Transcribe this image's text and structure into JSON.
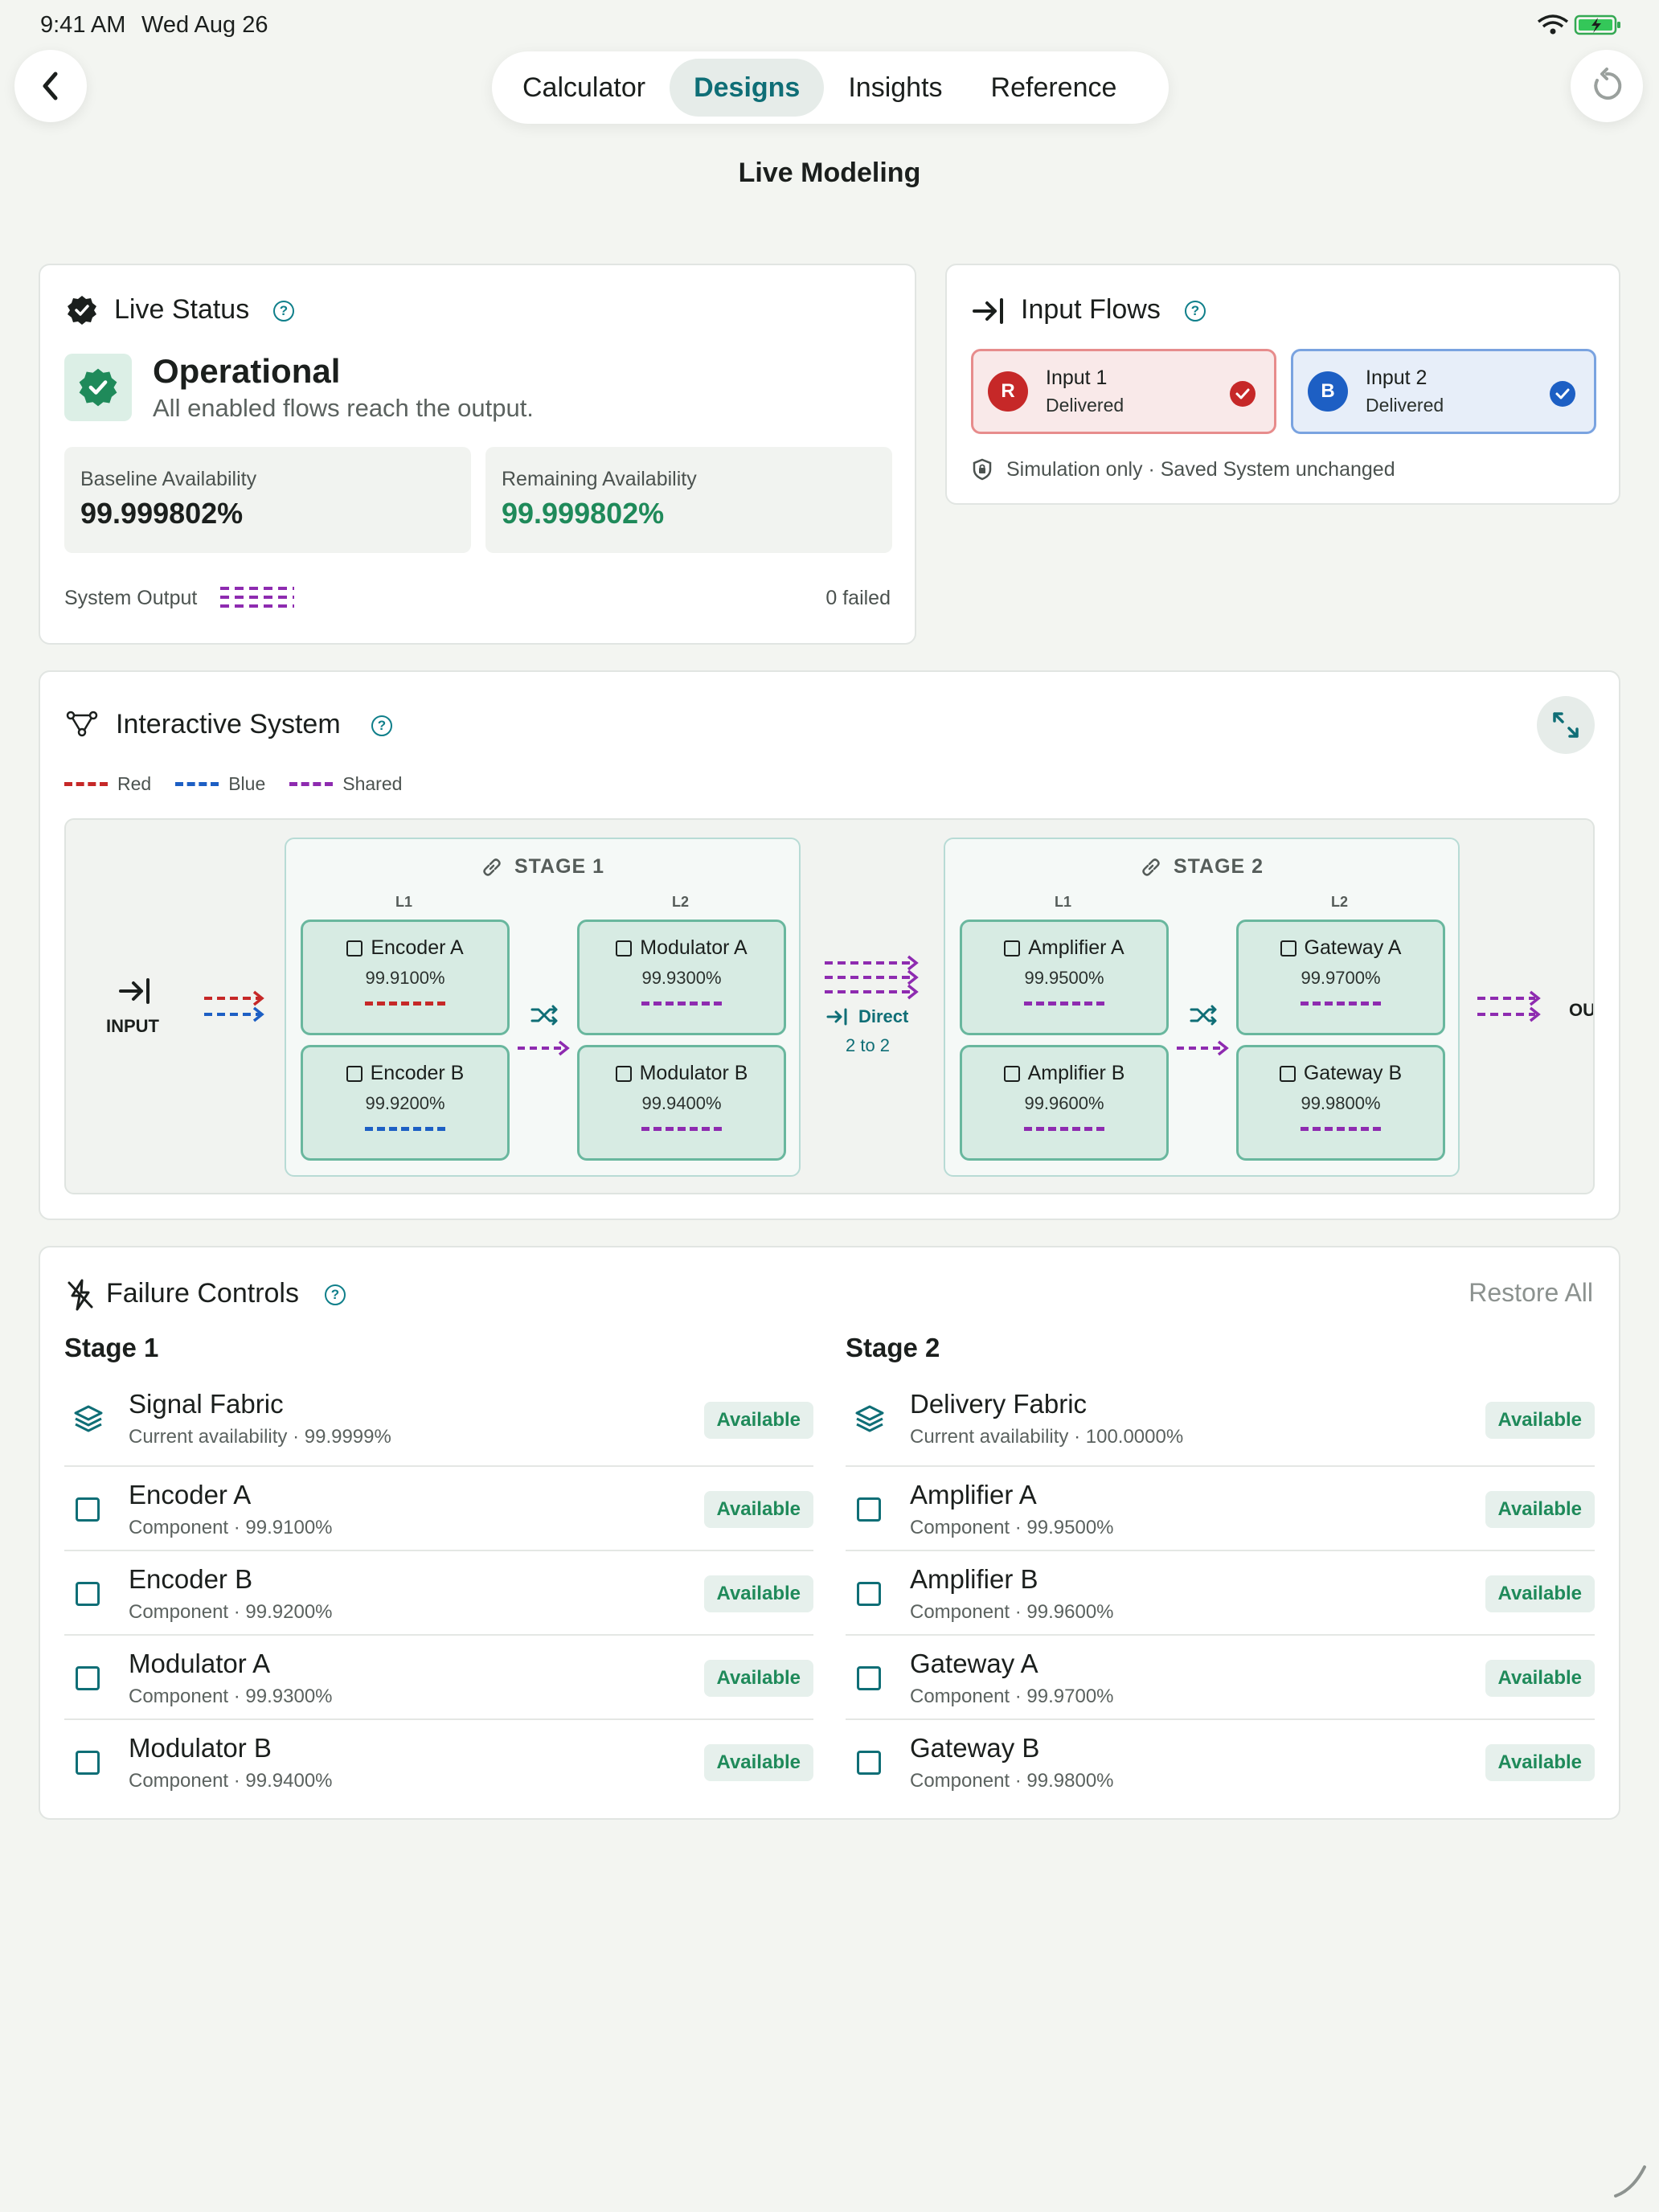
{
  "status_bar": {
    "time": "9:41 AM",
    "date": "Wed Aug 26"
  },
  "nav": {
    "tabs": [
      {
        "label": "Calculator",
        "active": false
      },
      {
        "label": "Designs",
        "active": true
      },
      {
        "label": "Insights",
        "active": false
      },
      {
        "label": "Reference",
        "active": false
      }
    ],
    "back_icon": "chevron-left-icon",
    "reset_icon": "reset-icon"
  },
  "page_title": "Live Modeling",
  "live_status": {
    "title": "Live Status",
    "state": "Operational",
    "description": "All enabled flows reach the output.",
    "baseline_label": "Baseline Availability",
    "baseline_value": "99.999802%",
    "remaining_label": "Remaining Availability",
    "remaining_value": "99.999802%",
    "output_label": "System Output",
    "failed_text": "0 failed"
  },
  "input_flows": {
    "title": "Input Flows",
    "flows": [
      {
        "badge": "R",
        "name": "Input 1",
        "status": "Delivered",
        "color": "#c62828"
      },
      {
        "badge": "B",
        "name": "Input 2",
        "status": "Delivered",
        "color": "#1d5fc4"
      }
    ],
    "note": "Simulation only · Saved System unchanged"
  },
  "interactive_system": {
    "title": "Interactive System",
    "legend": [
      {
        "label": "Red",
        "color": "#c62828"
      },
      {
        "label": "Blue",
        "color": "#1d5fc4"
      },
      {
        "label": "Shared",
        "color": "#8e2bb0"
      }
    ],
    "input_label": "INPUT",
    "output_label": "OU",
    "direct_label": "Direct",
    "direct_sub": "2 to 2",
    "stages": [
      {
        "title": "STAGE 1",
        "col1": "L1",
        "col2": "L2",
        "components": [
          {
            "name": "Encoder A",
            "value": "99.9100%",
            "color": "#c62828"
          },
          {
            "name": "Encoder B",
            "value": "99.9200%",
            "color": "#1d5fc4"
          },
          {
            "name": "Modulator A",
            "value": "99.9300%",
            "color": "#8e2bb0"
          },
          {
            "name": "Modulator B",
            "value": "99.9400%",
            "color": "#8e2bb0"
          }
        ]
      },
      {
        "title": "STAGE 2",
        "col1": "L1",
        "col2": "L2",
        "components": [
          {
            "name": "Amplifier A",
            "value": "99.9500%",
            "color": "#8e2bb0"
          },
          {
            "name": "Amplifier B",
            "value": "99.9600%",
            "color": "#8e2bb0"
          },
          {
            "name": "Gateway A",
            "value": "99.9700%",
            "color": "#8e2bb0"
          },
          {
            "name": "Gateway B",
            "value": "99.9800%",
            "color": "#8e2bb0"
          }
        ]
      }
    ]
  },
  "failure_controls": {
    "title": "Failure Controls",
    "restore_label": "Restore All",
    "columns": [
      {
        "heading": "Stage 1",
        "rows": [
          {
            "title": "Signal Fabric",
            "sub": "Current availability · 99.9999%",
            "badge": "Available",
            "icon": "layers-icon"
          },
          {
            "title": "Encoder A",
            "sub": "Component · 99.9100%",
            "badge": "Available",
            "icon": "checkbox-icon"
          },
          {
            "title": "Encoder B",
            "sub": "Component · 99.9200%",
            "badge": "Available",
            "icon": "checkbox-icon"
          },
          {
            "title": "Modulator A",
            "sub": "Component · 99.9300%",
            "badge": "Available",
            "icon": "checkbox-icon"
          },
          {
            "title": "Modulator B",
            "sub": "Component · 99.9400%",
            "badge": "Available",
            "icon": "checkbox-icon"
          }
        ]
      },
      {
        "heading": "Stage 2",
        "rows": [
          {
            "title": "Delivery Fabric",
            "sub": "Current availability · 100.0000%",
            "badge": "Available",
            "icon": "layers-icon"
          },
          {
            "title": "Amplifier A",
            "sub": "Component · 99.9500%",
            "badge": "Available",
            "icon": "checkbox-icon"
          },
          {
            "title": "Amplifier B",
            "sub": "Component · 99.9600%",
            "badge": "Available",
            "icon": "checkbox-icon"
          },
          {
            "title": "Gateway A",
            "sub": "Component · 99.9700%",
            "badge": "Available",
            "icon": "checkbox-icon"
          },
          {
            "title": "Gateway B",
            "sub": "Component · 99.9800%",
            "badge": "Available",
            "icon": "checkbox-icon"
          }
        ]
      }
    ]
  },
  "colors": {
    "accent": "#0f6e76",
    "success": "#1f8a5a",
    "red": "#c62828",
    "blue": "#1d5fc4",
    "shared": "#8e2bb0"
  }
}
